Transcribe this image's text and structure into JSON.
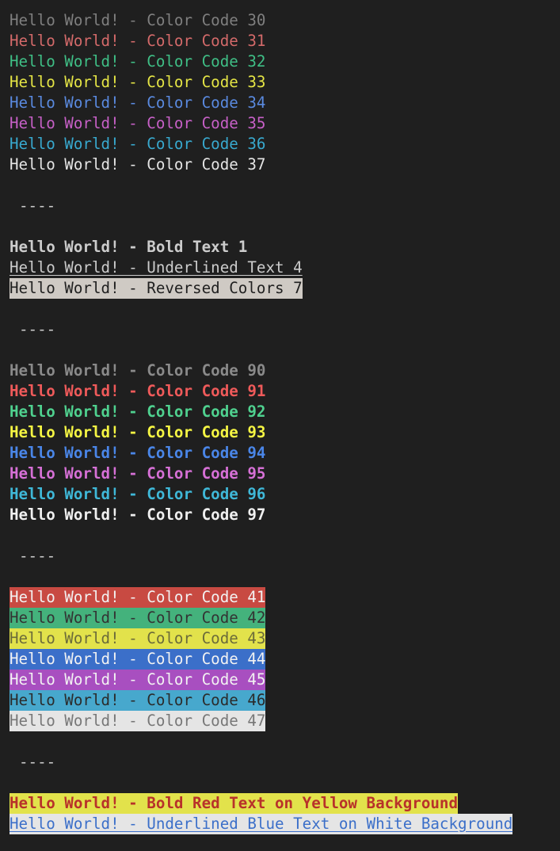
{
  "terminal": {
    "fg_lines": [
      {
        "text": "Hello World! - Color Code 30",
        "color": "#7f7f7f"
      },
      {
        "text": "Hello World! - Color Code 31",
        "color": "#d46a6a"
      },
      {
        "text": "Hello World! - Color Code 32",
        "color": "#3fbf86"
      },
      {
        "text": "Hello World! - Color Code 33",
        "color": "#e5e545"
      },
      {
        "text": "Hello World! - Color Code 34",
        "color": "#5a8ae0"
      },
      {
        "text": "Hello World! - Color Code 35",
        "color": "#c760c7"
      },
      {
        "text": "Hello World! - Color Code 36",
        "color": "#38a9cf"
      },
      {
        "text": "Hello World! - Color Code 37",
        "color": "#e5e5e5"
      }
    ],
    "separator": "----",
    "style_lines": [
      {
        "text": "Hello World! - Bold Text 1",
        "style": "bold",
        "color": "#cccccc",
        "bg": ""
      },
      {
        "text": "Hello World! - Underlined Text 4",
        "style": "underline",
        "color": "#cccccc",
        "bg": ""
      },
      {
        "text": "Hello World! - Reversed Colors 7",
        "style": "reverse",
        "color": "#1f1f1f",
        "bg": "#cfcac4"
      }
    ],
    "bright_lines": [
      {
        "text": "Hello World! - Color Code 90",
        "color": "#8a8a8a"
      },
      {
        "text": "Hello World! - Color Code 91",
        "color": "#ef5a5a"
      },
      {
        "text": "Hello World! - Color Code 92",
        "color": "#4fd18f"
      },
      {
        "text": "Hello World! - Color Code 93",
        "color": "#f5f543"
      },
      {
        "text": "Hello World! - Color Code 94",
        "color": "#4a86e8"
      },
      {
        "text": "Hello World! - Color Code 95",
        "color": "#d670d6"
      },
      {
        "text": "Hello World! - Color Code 96",
        "color": "#3fb8d8"
      },
      {
        "text": "Hello World! - Color Code 97",
        "color": "#f0f0f0"
      }
    ],
    "bg_lines": [
      {
        "text": "Hello World! - Color Code 41",
        "color": "#f2f2f2",
        "bg": "#c84a42"
      },
      {
        "text": "Hello World! - Color Code 42",
        "color": "#333333",
        "bg": "#44b27c"
      },
      {
        "text": "Hello World! - Color Code 43",
        "color": "#6b6b3a",
        "bg": "#e2e24b"
      },
      {
        "text": "Hello World! - Color Code 44",
        "color": "#f2f2f2",
        "bg": "#3b6fc9"
      },
      {
        "text": "Hello World! - Color Code 45",
        "color": "#f2f2f2",
        "bg": "#a84fc0"
      },
      {
        "text": "Hello World! - Color Code 46",
        "color": "#2b2b2b",
        "bg": "#47a8cd"
      },
      {
        "text": "Hello World! - Color Code 47",
        "color": "#777777",
        "bg": "#e5e5e5"
      }
    ],
    "combo_lines": [
      {
        "text": "Hello World! - Bold Red Text on Yellow Background",
        "color": "#b8322a",
        "bg": "#e2e24b",
        "style": "bold"
      },
      {
        "text": "Hello World! - Underlined Blue Text on White Background",
        "color": "#3b6fc9",
        "bg": "#e5e5e5",
        "style": "underline"
      }
    ]
  }
}
